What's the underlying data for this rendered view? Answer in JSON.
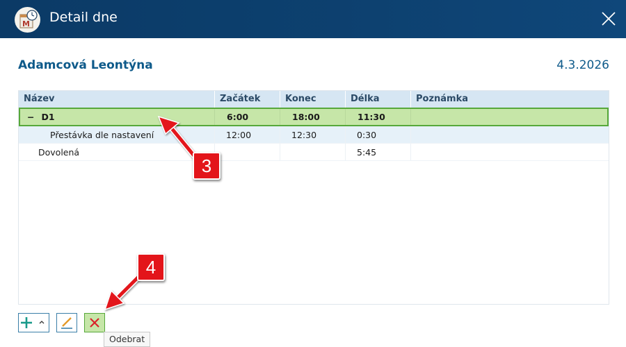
{
  "window": {
    "title": "Detail dne",
    "close_icon": "close-icon",
    "app_icon": "calendar-clock-icon"
  },
  "header": {
    "person_name": "Adamcová Leontýna",
    "date": "4.3.2026"
  },
  "grid": {
    "columns": [
      "Název",
      "Začátek",
      "Konec",
      "Délka",
      "Poznámka"
    ],
    "rows": [
      {
        "expander": "−",
        "name": "D1",
        "start": "6:00",
        "end": "18:00",
        "length": "11:30",
        "note": ""
      },
      {
        "name": "Přestávka dle nastavení",
        "start": "12:00",
        "end": "12:30",
        "length": "0:30",
        "note": ""
      },
      {
        "name": "Dovolená",
        "start": "",
        "end": "",
        "length": "5:45",
        "note": ""
      }
    ]
  },
  "toolbar": {
    "add_icon": "plus-icon",
    "add_dropdown_icon": "caret-up-icon",
    "edit_icon": "pencil-icon",
    "remove_icon": "x-icon",
    "remove_tooltip": "Odebrat"
  },
  "annotations": {
    "callout_3": "3",
    "callout_4": "4"
  },
  "colors": {
    "titlebar": "#0d4170",
    "accent_text": "#0e5a8a",
    "selected_row": "#c6e6a8",
    "selected_border": "#56a83a",
    "callout": "#e3151a"
  }
}
